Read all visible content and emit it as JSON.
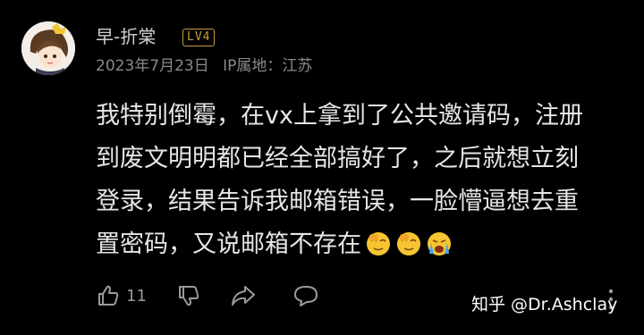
{
  "comment": {
    "username": "早-折棠",
    "level_badge": "LV4",
    "date": "2023年7月23日",
    "location": "IP属地：江苏",
    "lines": [
      "我特别倒霉，在vx上拿到了公共邀请码，注册",
      "到废文明明都已经全部搞好了，之后就想立刻",
      "登录，结果告诉我邮箱错误，一脸懵逼想去重",
      "置密码，又说邮箱不存在"
    ],
    "emojis": [
      "facepalm-emoji",
      "facepalm-emoji",
      "crying-emoji"
    ]
  },
  "actions": {
    "like_count": "11",
    "icons": [
      "thumbs-up-icon",
      "thumbs-down-icon",
      "share-icon",
      "comment-icon",
      "more-icon"
    ]
  },
  "watermark": "知乎 @Dr.Ashclay",
  "colors": {
    "background": "#000000",
    "text_primary": "#e6e6e6",
    "text_meta": "#8a8a8a",
    "badge": "#c79b3a",
    "icon": "#9a9a9a"
  }
}
